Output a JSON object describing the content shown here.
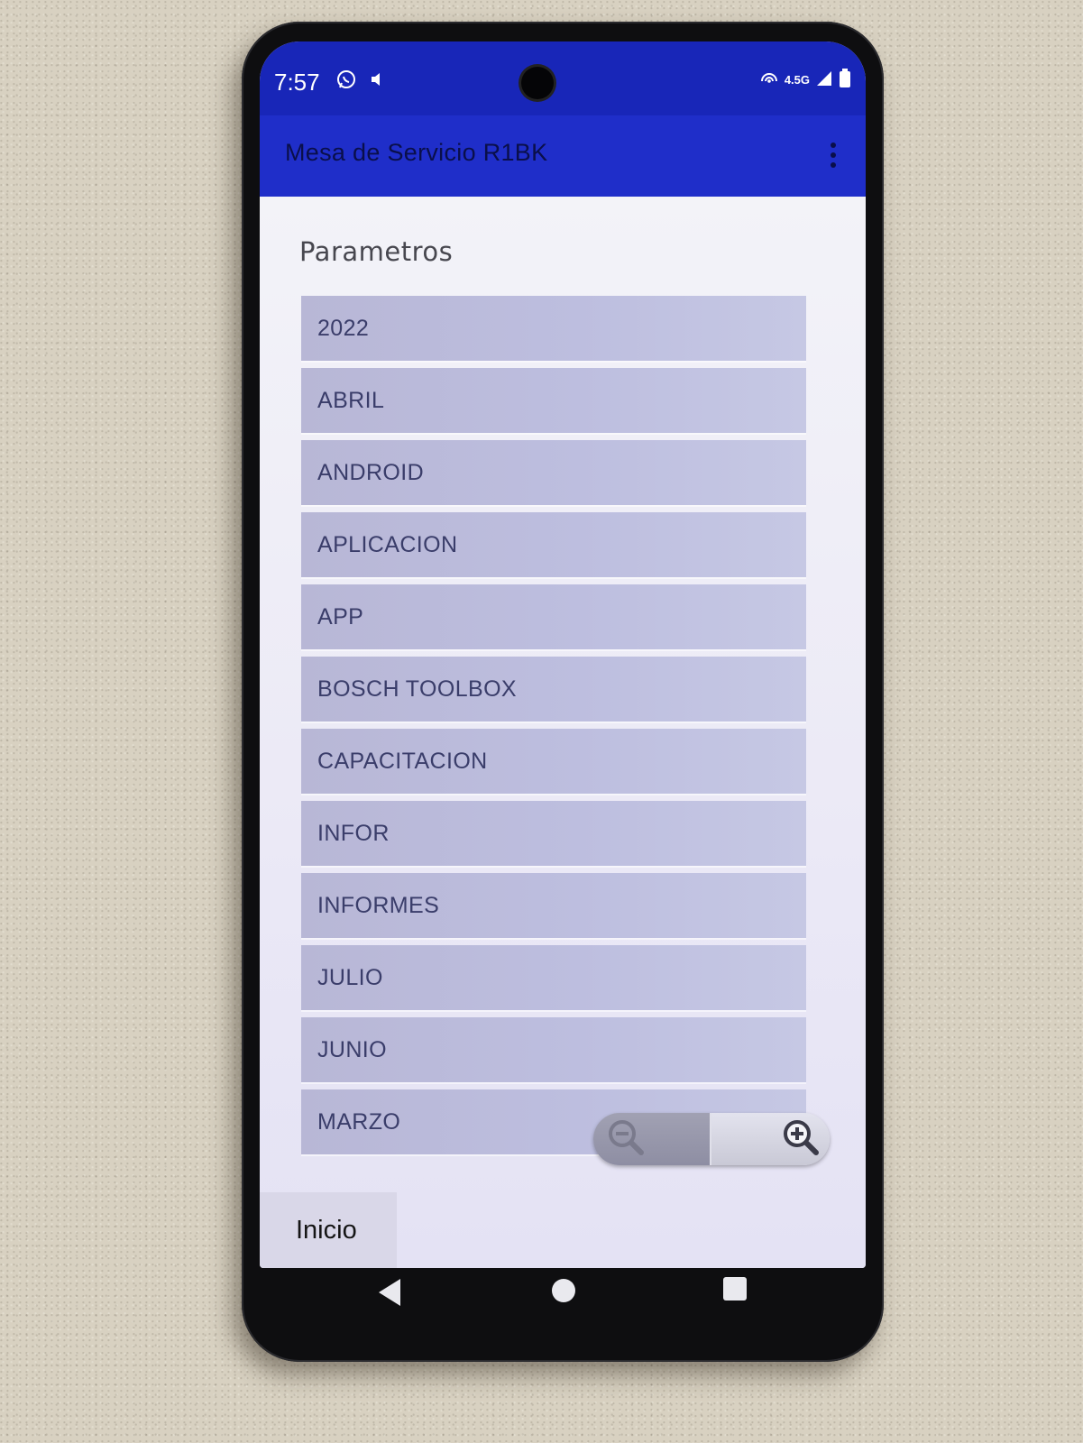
{
  "status_bar": {
    "time": "7:57",
    "network": "4.5G",
    "icons": [
      "whatsapp-icon",
      "volume-icon",
      "hotspot-icon",
      "signal-icon",
      "battery-icon"
    ]
  },
  "app_bar": {
    "title": "Mesa de Servicio R1BK",
    "menu_icon": "more-vert-icon"
  },
  "content": {
    "section_title": "Parametros",
    "items": [
      {
        "label": "2022"
      },
      {
        "label": "ABRIL"
      },
      {
        "label": "ANDROID"
      },
      {
        "label": "APLICACION"
      },
      {
        "label": "APP"
      },
      {
        "label": "BOSCH TOOLBOX"
      },
      {
        "label": "CAPACITACION"
      },
      {
        "label": "INFOR"
      },
      {
        "label": "INFORMES"
      },
      {
        "label": "JULIO"
      },
      {
        "label": "JUNIO"
      },
      {
        "label": "MARZO"
      }
    ]
  },
  "zoom": {
    "out_icon": "zoom-out-icon",
    "in_icon": "zoom-in-icon"
  },
  "bottom_tab": {
    "label": "Inicio"
  },
  "nav_bar": {
    "icons": [
      "back-icon",
      "home-icon",
      "recents-icon"
    ]
  },
  "colors": {
    "status_bar": "#1826b8",
    "app_bar": "#1f2ec9",
    "list_item": "#bcbcdc",
    "content_bg": "#ecebf4"
  }
}
